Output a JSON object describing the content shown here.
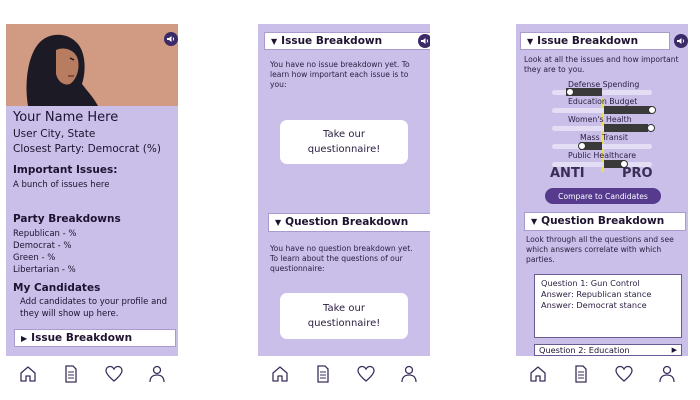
{
  "screen1": {
    "name": "Your Name Here",
    "location": "User City, State",
    "closest_party": "Closest Party: Democrat (%)",
    "important_issues_heading": "Important Issues:",
    "important_issues_text": "A bunch of issues here",
    "party_breakdowns_heading": "Party Breakdowns",
    "parties": [
      {
        "label": "Republican - %"
      },
      {
        "label": "Democrat - %"
      },
      {
        "label": "Green - %"
      },
      {
        "label": "Libertarian - %"
      }
    ],
    "my_candidates_heading": "My Candidates",
    "my_candidates_text_1": "Add candidates to your profile and",
    "my_candidates_text_2": "they will show up here.",
    "issue_breakdown_label": "Issue Breakdown"
  },
  "screen2": {
    "issue_breakdown_title": "Issue Breakdown",
    "issue_text_1": "You have no issue breakdown yet. To",
    "issue_text_2": "learn how important each issue is to",
    "issue_text_3": "you:",
    "questionnaire_line1": "Take our",
    "questionnaire_line2": "questionnaire!",
    "question_breakdown_title": "Question Breakdown",
    "question_text_1": "You have no question breakdown yet.",
    "question_text_2": "To learn about the questions of our",
    "question_text_3": "questionnaire:",
    "questionnaire2_line1": "Take our",
    "questionnaire2_line2": "questionnaire!"
  },
  "screen3": {
    "issue_breakdown_title": "Issue Breakdown",
    "intro_1": "Look at all the issues and how important",
    "intro_2": "they are to you.",
    "issues": [
      {
        "label": "Defense Spending"
      },
      {
        "label": "Education Budget"
      },
      {
        "label": "Women's Health"
      },
      {
        "label": "Mass Transit"
      },
      {
        "label": "Public Healthcare"
      }
    ],
    "anti_label": "ANTI",
    "pro_label": "PRO",
    "compare_button": "Compare to Candidates",
    "question_breakdown_title": "Question Breakdown",
    "q_intro_1": "Look through all the questions and see",
    "q_intro_2": "which answers correlate with which",
    "q_intro_3": "parties.",
    "question1": "Question 1: Gun Control",
    "answer1": "Answer: Republican stance",
    "answer2": "Answer: Democrat stance",
    "question2": "Question 2: Education"
  },
  "colors": {
    "background": "#c9bfe8",
    "accent": "#553a8e",
    "hero": "#d19b83"
  },
  "icons": [
    "speaker-icon",
    "home-icon",
    "document-icon",
    "heart-icon",
    "user-icon"
  ]
}
